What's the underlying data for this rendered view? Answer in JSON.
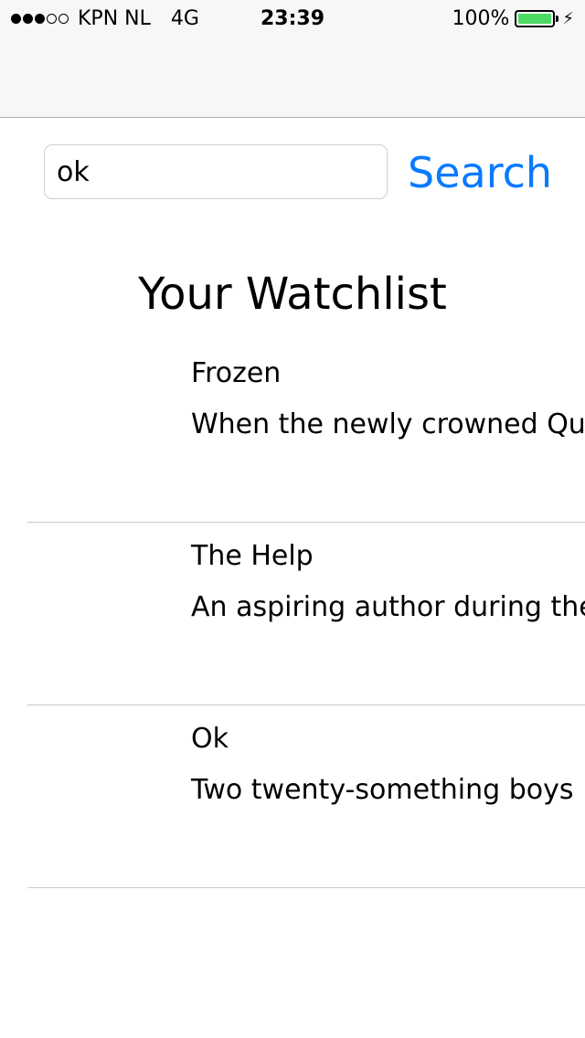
{
  "status_bar": {
    "signal_bars_filled": 3,
    "signal_bars_total": 5,
    "carrier": "KPN NL",
    "network": "4G",
    "time": "23:39",
    "battery_percent": "100%",
    "battery_level": 1.0,
    "battery_color": "#4cd964"
  },
  "search": {
    "value": "ok",
    "button_label": "Search",
    "accent_color": "#0a7aff"
  },
  "watchlist": {
    "title": "Your Watchlist",
    "items": [
      {
        "title": "Frozen",
        "description": "When the newly crowned Qu"
      },
      {
        "title": "The Help",
        "description": "An aspiring author during the"
      },
      {
        "title": "Ok",
        "description": "Two twenty-something boys"
      }
    ]
  }
}
